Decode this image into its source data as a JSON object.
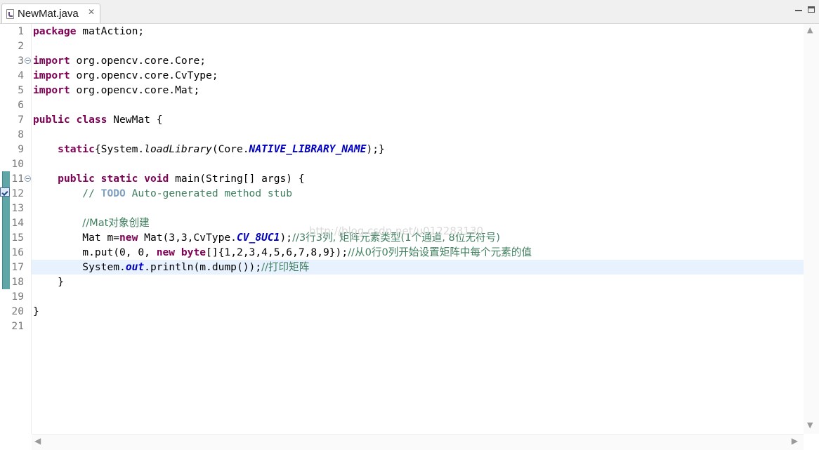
{
  "tab": {
    "title": "NewMat.java",
    "close_glyph": "✕"
  },
  "watermark": "http://blog.csdn.net/u012283130",
  "colors": {
    "keyword": "#7f0055",
    "comment": "#3f7f5f",
    "static_field": "#0000c0",
    "todo": "#7f9fbf",
    "current_line": "#e8f2fe",
    "change_bar": "#5fa6a6"
  },
  "line_numbers": [
    "1",
    "2",
    "3",
    "4",
    "5",
    "6",
    "7",
    "8",
    "9",
    "10",
    "11",
    "12",
    "13",
    "14",
    "15",
    "16",
    "17",
    "18",
    "19",
    "20",
    "21"
  ],
  "code": {
    "l1": {
      "kw": "package",
      "rest": " matAction;"
    },
    "l3": {
      "kw": "import",
      "rest": " org.opencv.core.Core;"
    },
    "l4": {
      "kw": "import",
      "rest": " org.opencv.core.CvType;"
    },
    "l5": {
      "kw": "import",
      "rest": " org.opencv.core.Mat;"
    },
    "l7": {
      "kw1": "public",
      "kw2": "class",
      "rest": " NewMat {"
    },
    "l9": {
      "indent": "    ",
      "kw": "static",
      "a": "{System.",
      "method": "loadLibrary",
      "b": "(Core.",
      "field": "NATIVE_LIBRARY_NAME",
      "c": ");}"
    },
    "l11": {
      "indent": "    ",
      "kw1": "public",
      "kw2": "static",
      "kw3": "void",
      "rest": " main(String[] args) {"
    },
    "l12": {
      "indent": "        ",
      "c1": "// ",
      "todo": "TODO",
      "c2": " Auto-generated method stub"
    },
    "l14": {
      "indent": "        ",
      "comment": "//Mat对象创建"
    },
    "l15": {
      "indent": "        ",
      "a": "Mat m=",
      "kw": "new",
      "b": " Mat(3,3,CvType.",
      "field": "CV_8UC1",
      "c": ");",
      "comment": "//3行3列, 矩阵元素类型(1个通道, 8位无符号)"
    },
    "l16": {
      "indent": "        ",
      "a": "m.put(0, 0, ",
      "kw1": "new",
      "kw2": "byte",
      "b": "[]{1,2,3,4,5,6,7,8,9});",
      "comment": "//从0行0列开始设置矩阵中每个元素的值"
    },
    "l17": {
      "indent": "        ",
      "a": "System.",
      "field": "out",
      "b": ".println(m.dump());",
      "comment": "//打印矩阵"
    },
    "l18": {
      "text": "    }"
    },
    "l20": {
      "text": "}"
    }
  },
  "icons": {
    "file": "java-file-icon",
    "fold": "fold-collapse-icon",
    "task": "task-marker-icon",
    "scroll_up": "▲",
    "scroll_down": "▼",
    "scroll_left": "◀",
    "scroll_right": "▶"
  }
}
